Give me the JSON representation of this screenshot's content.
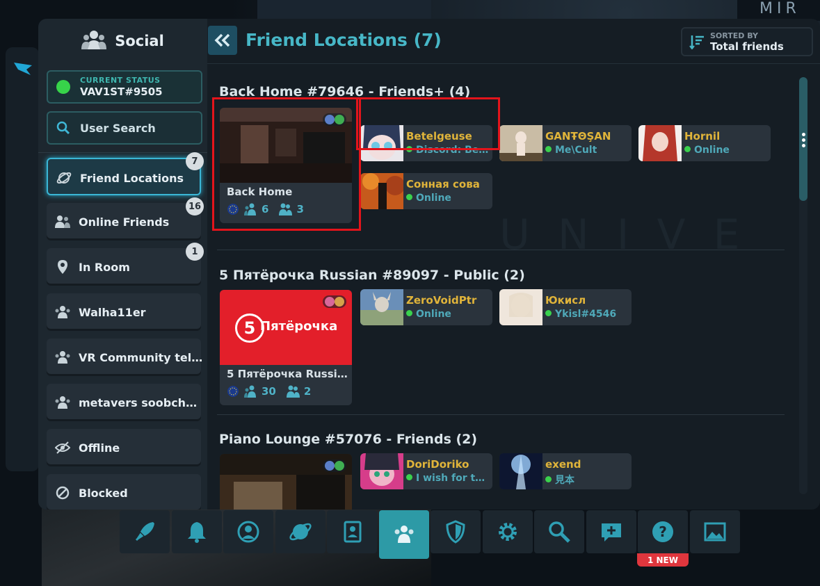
{
  "background": {
    "corner_text": "MIR"
  },
  "sidebar": {
    "title": "Social",
    "status": {
      "caption": "CURRENT STATUS",
      "name": "VAV1ST#9505",
      "color": "#37d34a"
    },
    "search_label": "User Search",
    "items": [
      {
        "label": "Friend Locations",
        "badge": "7",
        "icon": "planet-icon",
        "active": true
      },
      {
        "label": "Online Friends",
        "badge": "16",
        "icon": "friends-online-icon"
      },
      {
        "label": "In Room",
        "badge": "1",
        "icon": "location-pin-icon"
      },
      {
        "label": "Walha11er",
        "icon": "group-icon"
      },
      {
        "label": "VR Community tel…",
        "icon": "group-icon"
      },
      {
        "label": "metavers soobch…",
        "icon": "group-icon"
      },
      {
        "label": "Offline",
        "icon": "eye-off-icon"
      },
      {
        "label": "Blocked",
        "icon": "blocked-icon"
      }
    ]
  },
  "header": {
    "title": "Friend Locations (7)",
    "sort_caption": "SORTED BY",
    "sort_value": "Total friends"
  },
  "sections": [
    {
      "title": "Back Home #79646 - Friends+ (4)",
      "world": {
        "name": "Back Home",
        "users": "6",
        "friends": "3"
      },
      "friends": [
        {
          "name": "Betelgeuse",
          "status": "Discord: Bet…"
        },
        {
          "name": "GANŦΘŞAN",
          "status": "Me\\Cult"
        },
        {
          "name": "Hornil",
          "status": "Online"
        },
        {
          "name": "Сонная сова",
          "status": "Online"
        }
      ]
    },
    {
      "title": "5 Пятёрочка Russian #89097 - Public (2)",
      "world": {
        "name": "5 Пятёрочка Russi…",
        "logo_text": "Пятёрочка",
        "logo_digit": "5",
        "users": "30",
        "friends": "2"
      },
      "friends": [
        {
          "name": "ZeroVoidPtr",
          "status": "Online"
        },
        {
          "name": "Юкисл",
          "status": "Ykisl#4546"
        }
      ]
    },
    {
      "title": "Piano Lounge #57076 - Friends (2)",
      "friends": [
        {
          "name": "DoriDoriko",
          "status": "I wish for th…"
        },
        {
          "name": "exend",
          "status": "見本"
        }
      ]
    }
  ],
  "bottom_bar": {
    "buttons": [
      "rocket-icon",
      "bell-icon",
      "profile-icon",
      "planet-icon",
      "contacts-icon",
      "social-icon",
      "shield-icon",
      "gear-icon",
      "search-icon",
      "chat-add-icon",
      "help-icon",
      "gallery-icon"
    ],
    "help_badge": "1 NEW"
  },
  "colors": {
    "accent": "#47b7c7",
    "highlight": "#e3141b",
    "friend_name": "#e0b43a"
  }
}
